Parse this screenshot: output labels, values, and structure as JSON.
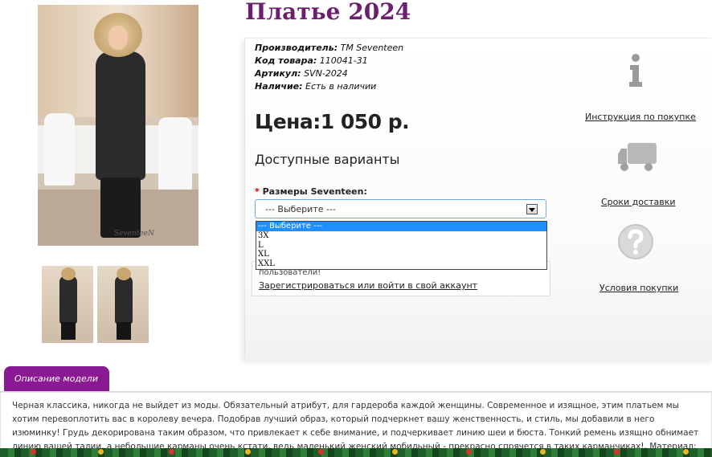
{
  "product": {
    "title": "Платье 2024",
    "manufacturer_label": "Производитель:",
    "manufacturer": "TM Seventeen",
    "code_label": "Код товара:",
    "code": "110041-31",
    "sku_label": "Артикул:",
    "sku": "SVN-2024",
    "availability_label": "Наличие:",
    "availability": "Есть в наличии",
    "price": "Цена:1 050 р.",
    "photo_signature": "SeventeeN"
  },
  "options": {
    "heading": "Доступные варианты",
    "size_required_mark": "*",
    "size_label": "Размеры Seventeen:",
    "selected": "--- Выберите ---",
    "items": [
      "--- Выберите ---",
      "3X",
      "L",
      "XL",
      "XXL"
    ]
  },
  "login": {
    "message": "пользователи!",
    "link": "Зарегистрироваться или войти в свой аккаунт"
  },
  "sidebar": {
    "instruction": "Инструкция по покупке",
    "delivery": "Сроки доставки",
    "terms": "Условия покупки",
    "icons": [
      "info-icon",
      "truck-icon",
      "question-icon"
    ]
  },
  "description": {
    "tab": "Описание модели",
    "text": "Черная классика, никогда не выйдет из моды. Обязательный атрибут, для гардероба каждой женщины. Современное и изящное, этим платьем мы хотим перевоплотить вас в королеву вечера. Подобрав лучший образ, который подчеркнет вашу женственность, и стиль, мы добавили в него изюминку! Грудь декорирована таким образом, что привлекает к себе внимание, и подчеркивает линию шеи и бюста. Тонкий ремень изящно обнимает линию вашей талии, а небольшие карманы очень кстати, ведь маленький женский мобильный - прекрасно спрячется в таких карманчиках!, Материал: трикотаж \"алекси\" , Длина"
  },
  "colors": {
    "title": "#6b1f6e",
    "tab": "#8a1a93",
    "dropdown_highlight": "#1e90ff",
    "required": "#d20000"
  }
}
